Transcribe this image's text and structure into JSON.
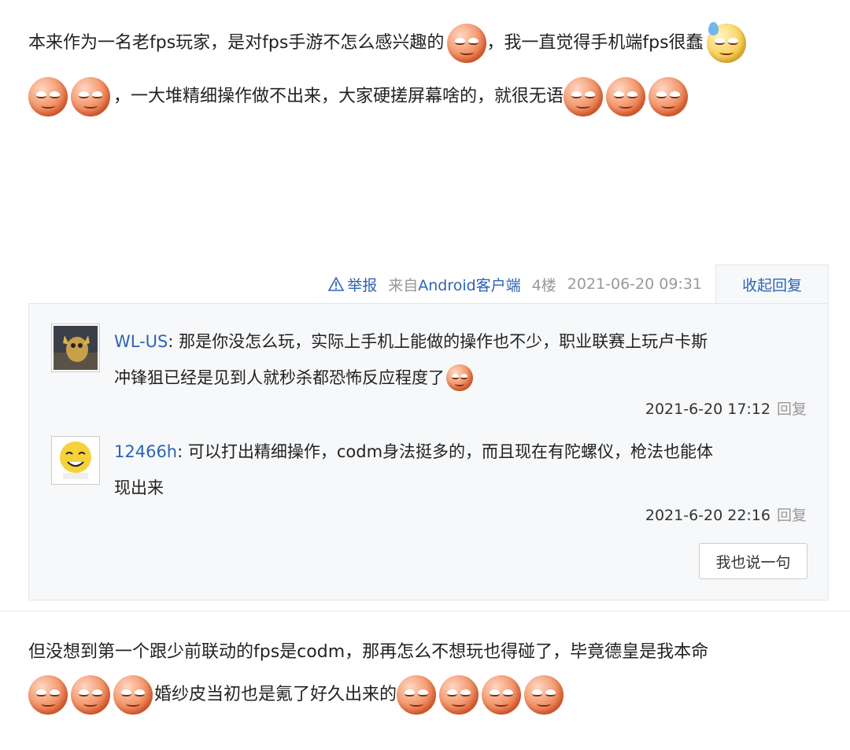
{
  "post1": {
    "line1_a": "本来作为一名老fps玩家，是对fps手游不怎么感兴趣的",
    "line1_b": "，我一直觉得手机端fps很蠢",
    "line2": "，一大堆精细操作做不出来，大家硬搓屏幕啥的，就很无语"
  },
  "meta": {
    "report": "举报",
    "from_prefix": "来自",
    "client": "Android客户端",
    "floor": "4楼",
    "datetime": "2021-06-20 09:31",
    "collapse": "收起回复"
  },
  "replies": [
    {
      "user": "WL-US",
      "text1": ": 那是你没怎么玩，实际上手机上能做的操作也不少，职业联赛上玩卢卡斯",
      "text2": "冲锋狙已经是见到人就秒杀都恐怖反应程度了",
      "time": "2021-6-20 17:12",
      "reply": "回复"
    },
    {
      "user": "12466h",
      "text1": ": 可以打出精细操作，codm身法挺多的，而且现在有陀螺仪，枪法也能体",
      "text2": "现出来",
      "time": "2021-6-20 22:16",
      "reply": "回复"
    }
  ],
  "say_button": "我也说一句",
  "post2": {
    "line1": "但没想到第一个跟少前联动的fps是codm，那再怎么不想玩也得碰了，毕竟德皇是我本命",
    "line2": "婚纱皮当初也是氪了好久出来的"
  },
  "colors": {
    "link": "#2d64b3",
    "muted": "#999999",
    "panel": "#f7f8fa",
    "border": "#e3e6eb"
  }
}
